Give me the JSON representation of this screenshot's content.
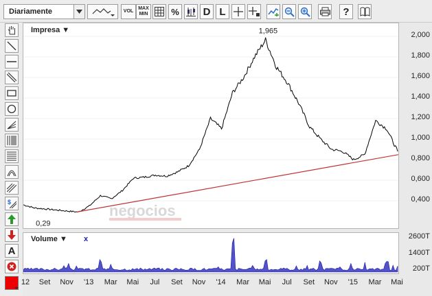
{
  "toolbar": {
    "period_value": "Diariamente",
    "vol_label": "VOL",
    "maxmin_line1": "MAX",
    "maxmin_line2": "MIN",
    "percent_label": "%",
    "d_label": "D",
    "l_label": "L",
    "help_label": "?"
  },
  "main_chart": {
    "instrument_label": "Impresa ▼",
    "max_annotation": "1,965",
    "min_annotation": "0,29",
    "watermark": "negocios",
    "y_ticks": [
      "2,000",
      "1,800",
      "1,600",
      "1,400",
      "1,200",
      "1,000",
      "0,800",
      "0,600",
      "0,400"
    ]
  },
  "volume_chart": {
    "label": "Volume ▼",
    "close_label": "x",
    "y_ticks": [
      "2600T",
      "1400T",
      "200T"
    ]
  },
  "x_axis": {
    "ticks": [
      "12",
      "Set",
      "Nov",
      "'13",
      "Mar",
      "Mai",
      "Jul",
      "Set",
      "Nov",
      "'14",
      "Mar",
      "Mai",
      "Jul",
      "Set",
      "Nov",
      "'15",
      "Mar",
      "Mai"
    ]
  },
  "chart_data": {
    "type": "line",
    "series": [
      {
        "x": [
          "2012-07",
          "2012-08",
          "2012-09",
          "2012-10",
          "2012-11",
          "2012-12",
          "2013-01",
          "2013-02",
          "2013-03",
          "2013-04",
          "2013-05",
          "2013-06",
          "2013-07",
          "2013-08",
          "2013-09",
          "2013-10",
          "2013-11",
          "2013-12",
          "2014-01",
          "2014-02",
          "2014-03",
          "2014-04",
          "2014-05",
          "2014-06",
          "2014-07",
          "2014-08",
          "2014-09",
          "2014-10",
          "2014-11",
          "2014-12",
          "2015-01",
          "2015-02",
          "2015-03",
          "2015-04",
          "2015-05"
        ],
        "values": [
          0.36,
          0.33,
          0.32,
          0.31,
          0.3,
          0.29,
          0.35,
          0.45,
          0.42,
          0.5,
          0.62,
          0.63,
          0.65,
          0.64,
          0.68,
          0.74,
          0.9,
          1.2,
          1.1,
          1.45,
          1.6,
          1.8,
          1.965,
          1.7,
          1.55,
          1.35,
          1.12,
          1.0,
          0.9,
          0.88,
          0.8,
          0.85,
          1.18,
          1.1,
          0.88
        ]
      }
    ],
    "trendline": {
      "from": [
        "2012-12",
        0.29
      ],
      "to": [
        "2015-05",
        0.85
      ],
      "color": "#c03030"
    },
    "ylim": [
      0.2,
      2.05
    ],
    "volume": {
      "ylim": [
        0,
        2800
      ],
      "peaks": [
        {
          "x": "2013-02",
          "value": 1000
        },
        {
          "x": "2014-02",
          "value": 2700
        },
        {
          "x": "2014-05",
          "value": 1100
        },
        {
          "x": "2014-10",
          "value": 900
        },
        {
          "x": "2015-04",
          "value": 800
        }
      ]
    },
    "colors": {
      "price": "#000000",
      "volume": "#1a1ab4",
      "trend": "#c03030"
    }
  }
}
